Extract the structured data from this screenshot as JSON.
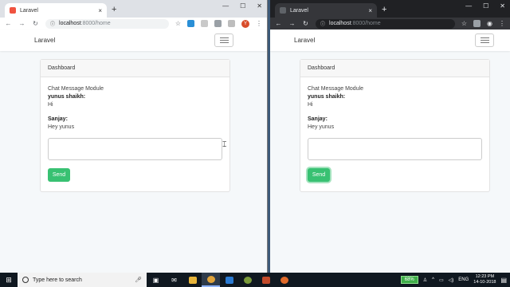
{
  "left_window": {
    "tab_title": "Laravel",
    "url_host": "localhost",
    "url_path": ":8000/home",
    "avatar_letter": "Y"
  },
  "right_window": {
    "tab_title": "Laravel",
    "url_host": "localhost",
    "url_path": ":8000/home"
  },
  "app": {
    "brand": "Laravel",
    "card_header": "Dashboard",
    "module_title": "Chat Message Module",
    "messages": [
      {
        "user": "yunus shaikh:",
        "text": "Hi"
      },
      {
        "user": "Sanjay:",
        "text": "Hey yunus"
      }
    ],
    "send_label": "Send"
  },
  "icons": {
    "back": "arrow-left-icon",
    "forward": "arrow-right-icon",
    "reload": "reload-icon",
    "info": "info-icon",
    "star": "star-icon",
    "menu": "kebab-menu-icon"
  },
  "colors": {
    "send_button": "#38c172",
    "taskbar": "#101820",
    "dark_chrome": "#202124",
    "light_chrome": "#dee1e6"
  },
  "taskbar": {
    "search_placeholder": "Type here to search",
    "battery": "68%",
    "language": "ENG",
    "time": "12:23 PM",
    "date": "14-10-2018"
  }
}
